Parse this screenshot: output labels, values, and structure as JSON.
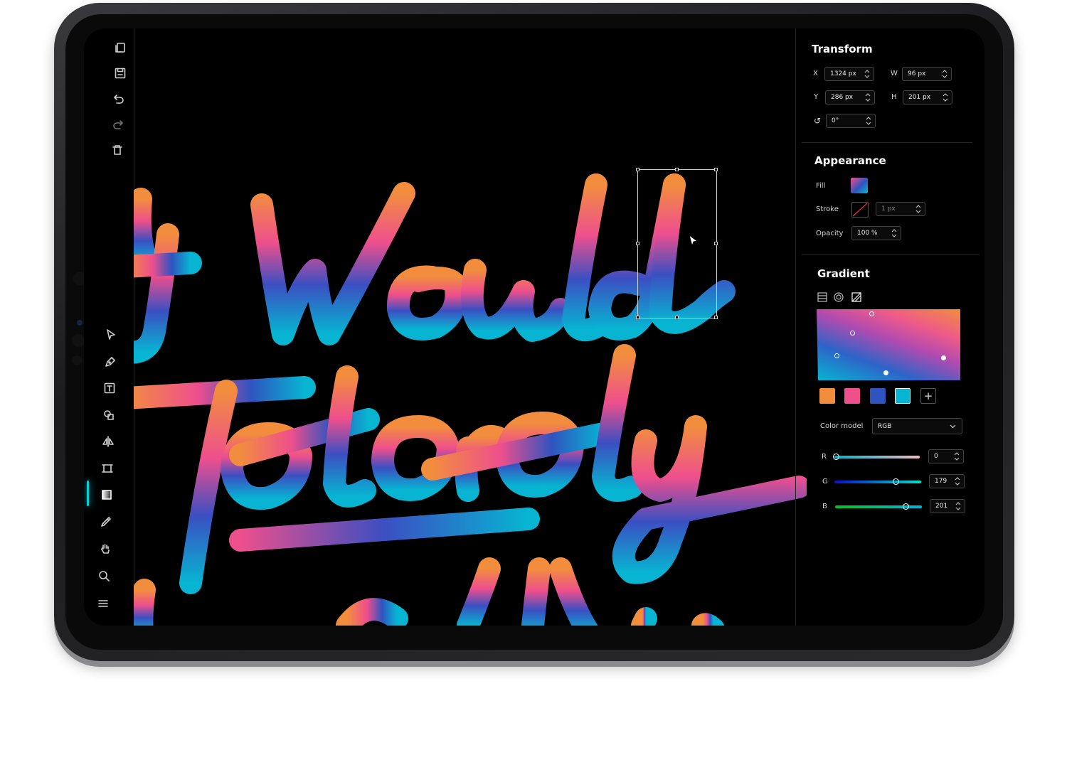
{
  "transform": {
    "title": "Transform",
    "x_label": "X",
    "x_value": "1324 px",
    "y_label": "Y",
    "y_value": "286 px",
    "w_label": "W",
    "w_value": "96 px",
    "h_label": "H",
    "h_value": "201 px",
    "rotation_label": "↺",
    "rotation_value": "0°"
  },
  "appearance": {
    "title": "Appearance",
    "fill_label": "Fill",
    "stroke_label": "Stroke",
    "stroke_width": "1 px",
    "opacity_label": "Opacity",
    "opacity_value": "100 %"
  },
  "gradient": {
    "title": "Gradient",
    "swatches": [
      "#f28d3e",
      "#ee4f8d",
      "#2f54c0",
      "#07b5d2"
    ],
    "add_label": "+",
    "color_model_label": "Color model",
    "color_model_value": "RGB",
    "r_label": "R",
    "r_value": "0",
    "g_label": "G",
    "g_value": "179",
    "b_label": "B",
    "b_value": "201"
  },
  "tools": {
    "top": [
      "pages-icon",
      "save-icon",
      "undo-icon",
      "redo-icon",
      "delete-icon"
    ],
    "bottom": [
      "select-icon",
      "pen-icon",
      "text-icon",
      "shapes-icon",
      "mirror-icon",
      "frame-icon",
      "gradient-icon",
      "eyedropper-icon",
      "hand-icon",
      "zoom-icon",
      "menu-icon"
    ],
    "active": "gradient-icon"
  },
  "colors": {
    "accent": "#00d0d8",
    "stroke_orange": "#f28d3e",
    "stroke_pink": "#ee4f8d",
    "stroke_blue": "#2f54c0",
    "stroke_cyan": "#07b5d2"
  }
}
